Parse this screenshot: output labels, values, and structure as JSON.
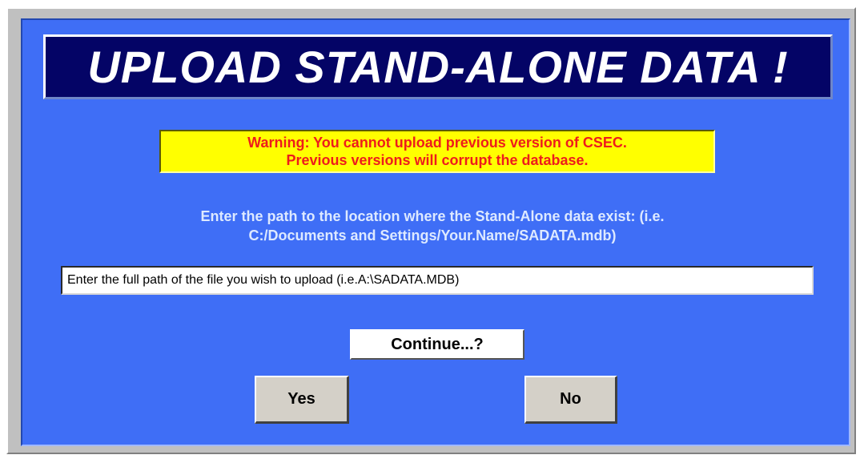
{
  "title": "UPLOAD STAND-ALONE DATA !",
  "warning": {
    "line1": "Warning:  You cannot upload previous version of CSEC.",
    "line2": "Previous versions will corrupt the database."
  },
  "instructions": {
    "line1": "Enter the path to the location where the Stand-Alone data exist: (i.e.",
    "line2": "C:/Documents and Settings/Your.Name/SADATA.mdb)"
  },
  "path_input": {
    "value": "",
    "placeholder": "Enter the full path of the file you wish to upload (i.e.A:\\SADATA.MDB)"
  },
  "continue_label": "Continue...?",
  "buttons": {
    "yes": "Yes",
    "no": "No"
  },
  "colors": {
    "panel": "#3f6ef6",
    "banner": "#040466",
    "warning_bg": "#ffff00",
    "warning_text": "#ee1c1c"
  }
}
